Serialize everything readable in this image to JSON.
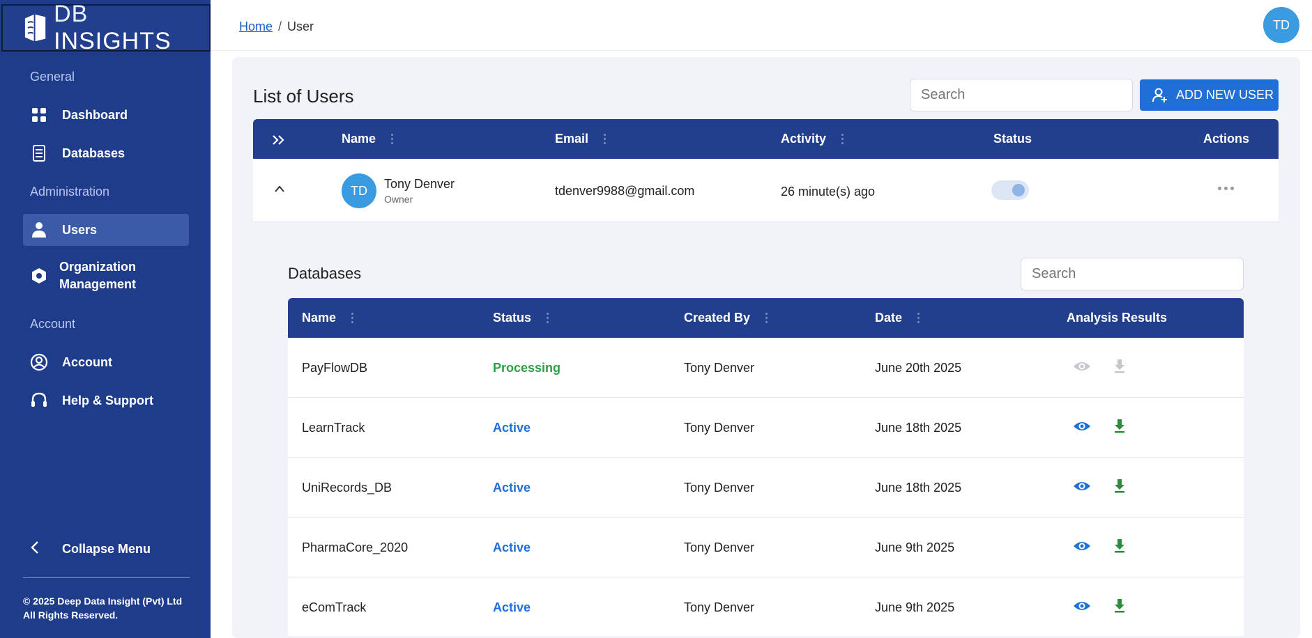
{
  "brand": {
    "logo_db": "DB",
    "logo_rest": "INSIGHTS"
  },
  "sidebar": {
    "sections": [
      {
        "label": "General",
        "items": [
          {
            "label": "Dashboard",
            "icon": "grid-icon"
          },
          {
            "label": "Databases",
            "icon": "document-icon"
          }
        ]
      },
      {
        "label": "Administration",
        "items": [
          {
            "label": "Users",
            "icon": "user-icon",
            "active": true
          },
          {
            "label": "Organization Management",
            "icon": "hexagon-icon"
          }
        ]
      },
      {
        "label": "Account",
        "items": [
          {
            "label": "Account",
            "icon": "account-circle-icon"
          },
          {
            "label": "Help & Support",
            "icon": "headset-icon"
          }
        ]
      }
    ],
    "org_line1": "Organization",
    "org_line2": "Management",
    "collapse_label": "Collapse Menu",
    "copyright_line1": "© 2025 Deep Data Insight (Pvt) Ltd",
    "copyright_line2": "All Rights Reserved."
  },
  "breadcrumb": {
    "home": "Home",
    "separator": "/",
    "current": "User"
  },
  "top_avatar_initials": "TD",
  "users": {
    "title": "List of Users",
    "search_placeholder": "Search",
    "add_button": "ADD NEW USER",
    "columns": {
      "name": "Name",
      "email": "Email",
      "activity": "Activity",
      "status": "Status",
      "actions": "Actions"
    },
    "row": {
      "initials": "TD",
      "name": "Tony Denver",
      "role": "Owner",
      "email": "tdenver9988@gmail.com",
      "activity": "26 minute(s) ago",
      "status_enabled": true
    }
  },
  "databases": {
    "title": "Databases",
    "search_placeholder": "Search",
    "columns": {
      "name": "Name",
      "status": "Status",
      "created_by": "Created By",
      "date": "Date",
      "analysis": "Analysis Results"
    },
    "rows": [
      {
        "name": "PayFlowDB",
        "status": "Processing",
        "created_by": "Tony Denver",
        "date": "June 20th 2025",
        "actions_enabled": false
      },
      {
        "name": "LearnTrack",
        "status": "Active",
        "created_by": "Tony Denver",
        "date": "June 18th 2025",
        "actions_enabled": true
      },
      {
        "name": "UniRecords_DB",
        "status": "Active",
        "created_by": "Tony Denver",
        "date": "June 18th 2025",
        "actions_enabled": true
      },
      {
        "name": "PharmaCore_2020",
        "status": "Active",
        "created_by": "Tony Denver",
        "date": "June 9th 2025",
        "actions_enabled": true
      },
      {
        "name": "eComTrack",
        "status": "Active",
        "created_by": "Tony Denver",
        "date": "June 9th 2025",
        "actions_enabled": true
      }
    ]
  },
  "colors": {
    "sidebar": "#1f3c8a",
    "header": "#223f8e",
    "primary": "#1f6fd6",
    "success": "#2e9d47",
    "avatar": "#3a9be0"
  }
}
